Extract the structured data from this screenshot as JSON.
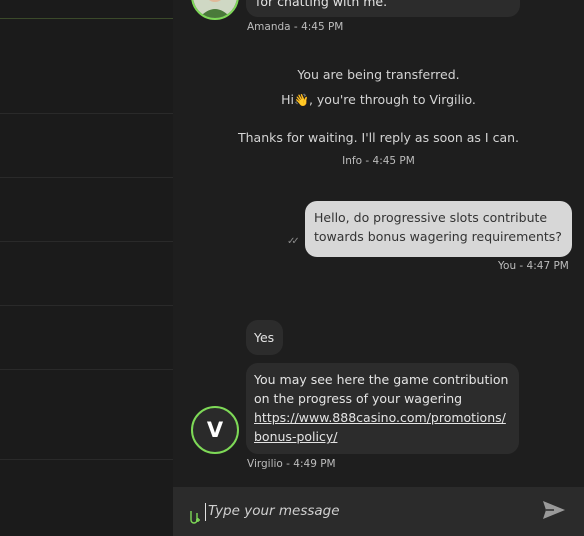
{
  "chat": {
    "prev_message": {
      "text_partial": "for chatting with me.",
      "sender_time": "Amanda - 4:45 PM"
    },
    "system": {
      "line1": "You are being transferred.",
      "line2_prefix": "Hi",
      "line2_suffix": ", you're through to Virgilio.",
      "line2_emoji": "👋",
      "line3": "Thanks for waiting. I'll reply as soon as I can.",
      "meta": "Info - 4:45 PM"
    },
    "user_message": {
      "line1": "Hello, do progressive slots contribute",
      "line2": "towards bonus wagering requirements?",
      "meta": "You - 4:47 PM",
      "status_icon": "double-check-icon"
    },
    "agent_messages": {
      "short": "Yes",
      "long_line1": "You may see here the game contribution",
      "long_line2": "on the progress of your wagering",
      "link_line1": "https://www.888casino.com/promotions/",
      "link_line2": "bonus-policy/",
      "meta": "Virgilio - 4:49 PM",
      "avatar_letter": "V"
    }
  },
  "composer": {
    "placeholder": "Type your message",
    "attach_icon": "paperclip-icon",
    "send_icon": "send-icon"
  },
  "colors": {
    "accent": "#7ed957",
    "panel": "#1e1e1e",
    "bubble_agent": "#2c2c2c",
    "bubble_user": "#d7d7d7"
  }
}
